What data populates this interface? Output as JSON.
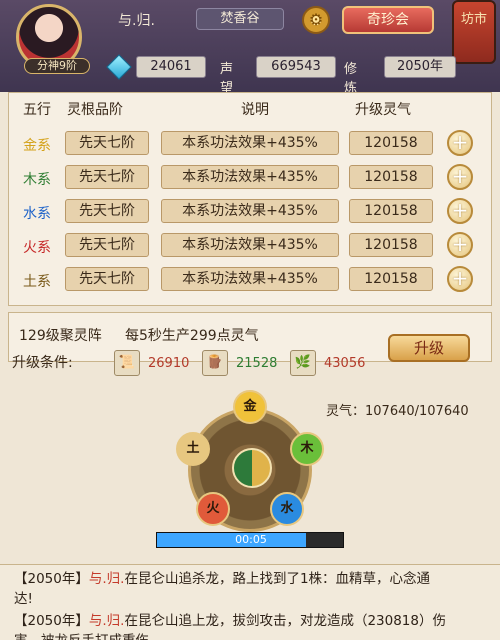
{
  "header": {
    "rank_badge": "分神9阶",
    "player_name": "与.归.",
    "sect_name": "焚香谷",
    "treasure_button": "奇珍会",
    "market_label": "坊市",
    "stats": {
      "currency_value": "24061",
      "reputation_label": "声望",
      "reputation_value": "669543",
      "cultivation_label": "修炼",
      "cultivation_year": "2050年"
    }
  },
  "table": {
    "headers": [
      "五行",
      "灵根品阶",
      "说明",
      "升级灵气"
    ],
    "rows": [
      {
        "element": "金系",
        "color": "#d4a21a",
        "grade": "先天七阶",
        "effect": "本系功法效果+435%",
        "cost": "120158"
      },
      {
        "element": "木系",
        "color": "#2e7d32",
        "grade": "先天七阶",
        "effect": "本系功法效果+435%",
        "cost": "120158"
      },
      {
        "element": "水系",
        "color": "#1e63c9",
        "grade": "先天七阶",
        "effect": "本系功法效果+435%",
        "cost": "120158"
      },
      {
        "element": "火系",
        "color": "#c62828",
        "grade": "先天七阶",
        "effect": "本系功法效果+435%",
        "cost": "120158"
      },
      {
        "element": "土系",
        "color": "#7a5a1a",
        "grade": "先天七阶",
        "effect": "本系功法效果+435%",
        "cost": "120158"
      }
    ]
  },
  "array": {
    "title": "129级聚灵阵",
    "description": "每5秒生产299点灵气",
    "requirement_label": "升级条件:",
    "resources": [
      {
        "icon": "scroll-icon",
        "value": "26910",
        "color": "#b33a2a"
      },
      {
        "icon": "wood-icon",
        "value": "21528",
        "color": "#2e7d32"
      },
      {
        "icon": "herb-icon",
        "value": "43056",
        "color": "#b33a2a"
      }
    ],
    "upgrade_button": "升级"
  },
  "wheel": {
    "lingqi_text": "灵气：107640/107640",
    "nodes": [
      {
        "label": "金",
        "color": "#f0c23a"
      },
      {
        "label": "木",
        "color": "#6abf3a"
      },
      {
        "label": "水",
        "color": "#2a8be0"
      },
      {
        "label": "火",
        "color": "#e05a3a"
      },
      {
        "label": "土",
        "color": "#e7c780"
      }
    ],
    "timer": "00:05",
    "progress": 0.8
  },
  "log": {
    "line1_prefix": "【2050年】",
    "line1_name": "与.归.",
    "line1_text": "在昆仑山追杀龙，路上找到了1株：血精草，心念通",
    "line2_text": "达!",
    "line3_prefix": "【2050年】",
    "line3_name": "与.归.",
    "line3_text": "在昆仑山追上龙，拔剑攻击，对龙造成（230818）伤",
    "line4_text": "害，被龙反手打成重伤"
  }
}
